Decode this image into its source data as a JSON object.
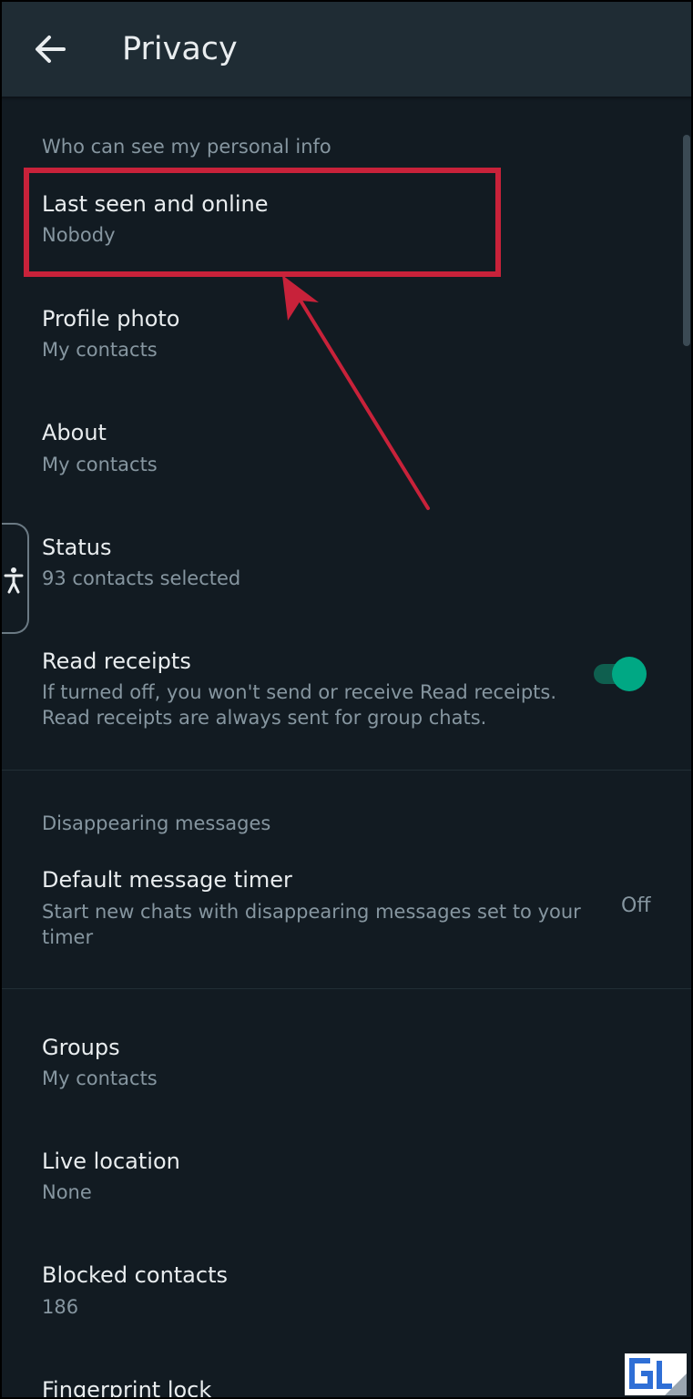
{
  "header": {
    "title": "Privacy",
    "back_icon": "arrow-back-icon"
  },
  "sections": {
    "personal_info": "Who can see my personal info",
    "disappearing": "Disappearing messages"
  },
  "items": {
    "last_seen": {
      "title": "Last seen and online",
      "value": "Nobody"
    },
    "profile_photo": {
      "title": "Profile photo",
      "value": "My contacts"
    },
    "about": {
      "title": "About",
      "value": "My contacts"
    },
    "status": {
      "title": "Status",
      "value": "93 contacts selected"
    },
    "read_receipts": {
      "title": "Read receipts",
      "desc_line1": "If turned off, you won't send or receive Read receipts.",
      "desc_line2": "Read receipts are always sent for group chats.",
      "enabled": true
    },
    "default_timer": {
      "title": "Default message timer",
      "desc_line1": "Start new chats with disappearing messages set to your",
      "desc_line2": "timer",
      "value": "Off"
    },
    "groups": {
      "title": "Groups",
      "value": "My contacts"
    },
    "live_location": {
      "title": "Live location",
      "value": "None"
    },
    "blocked": {
      "title": "Blocked contacts",
      "value": "186"
    },
    "fingerprint": {
      "title": "Fingerprint lock"
    }
  },
  "colors": {
    "background": "#121b22",
    "appbar": "#1f2c34",
    "accent": "#00a884",
    "annotation": "#c8223a"
  }
}
